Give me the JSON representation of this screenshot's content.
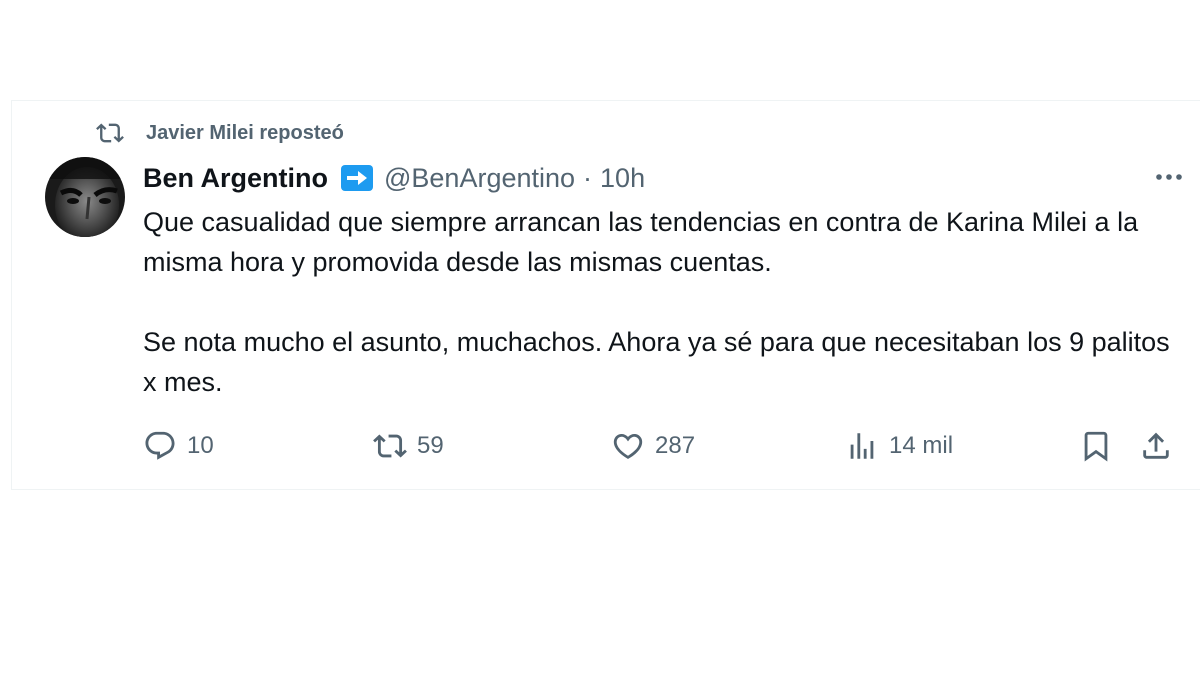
{
  "repost": {
    "icon": "repost-icon",
    "label": "Javier Milei reposteó"
  },
  "author": {
    "name": "Ben Argentino",
    "badge_icon": "arrow-right-badge-icon",
    "handle": "@BenArgentino",
    "separator": "·",
    "time": "10h"
  },
  "post": {
    "paragraph1": "Que casualidad que siempre arrancan las tendencias en contra de Karina Milei a la misma hora y promovida desde las mismas cuentas.",
    "paragraph2": "Se nota mucho el asunto, muchachos. Ahora ya sé para que necesitaban los 9 palitos x mes."
  },
  "actions": {
    "replies": "10",
    "reposts": "59",
    "likes": "287",
    "views": "14 mil"
  },
  "colors": {
    "text": "#0f1419",
    "muted": "#536471",
    "border": "#eff3f4",
    "badge": "#1d9bf0"
  }
}
